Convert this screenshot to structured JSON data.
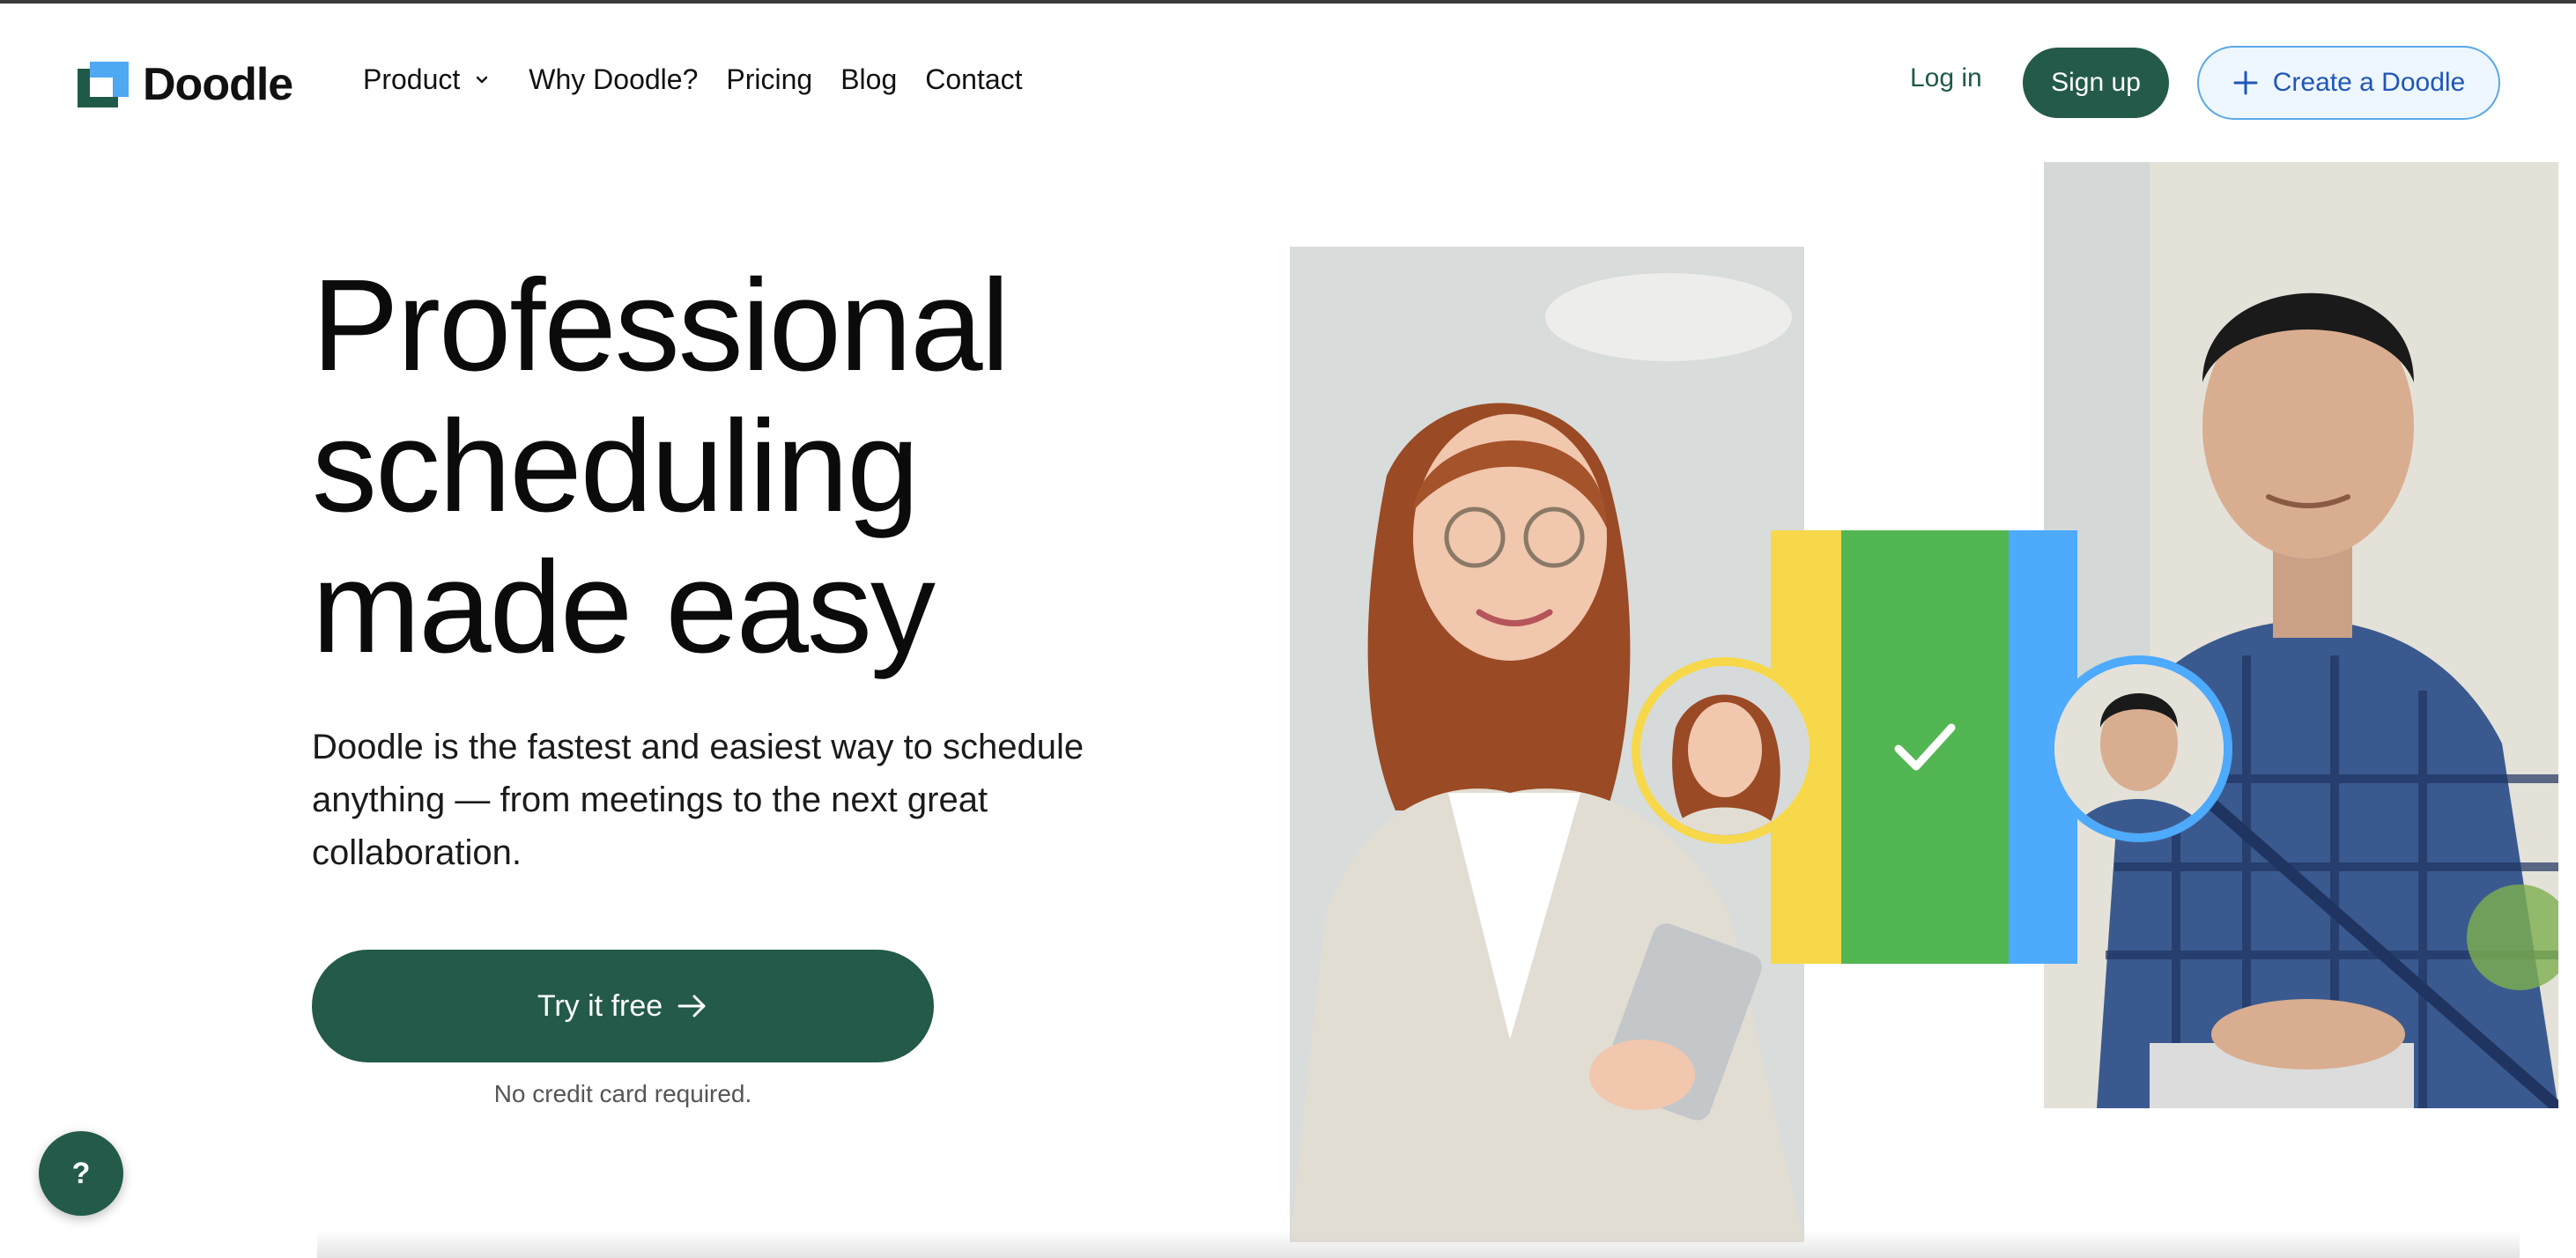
{
  "brand": {
    "name": "Doodle"
  },
  "nav": {
    "product": "Product",
    "why": "Why Doodle?",
    "pricing": "Pricing",
    "blog": "Blog",
    "contact": "Contact"
  },
  "auth": {
    "login": "Log in",
    "signup": "Sign up",
    "create": "Create a Doodle"
  },
  "hero": {
    "headline_line1": "Professional",
    "headline_line2": "scheduling",
    "headline_line3": "made easy",
    "subtext": "Doodle is the fastest and easiest way to schedule anything — from meetings to the next great collaboration.",
    "cta": "Try it free",
    "note": "No credit card required."
  },
  "help": {
    "label": "?"
  },
  "colors": {
    "brand_green": "#235a49",
    "accent_blue": "#4daafc",
    "accent_yellow": "#f6d84a",
    "accent_green": "#52b653"
  },
  "icons": {
    "chevron": "chevron-down-icon",
    "plus": "plus-icon",
    "arrow": "arrow-right-icon",
    "check": "check-icon"
  }
}
